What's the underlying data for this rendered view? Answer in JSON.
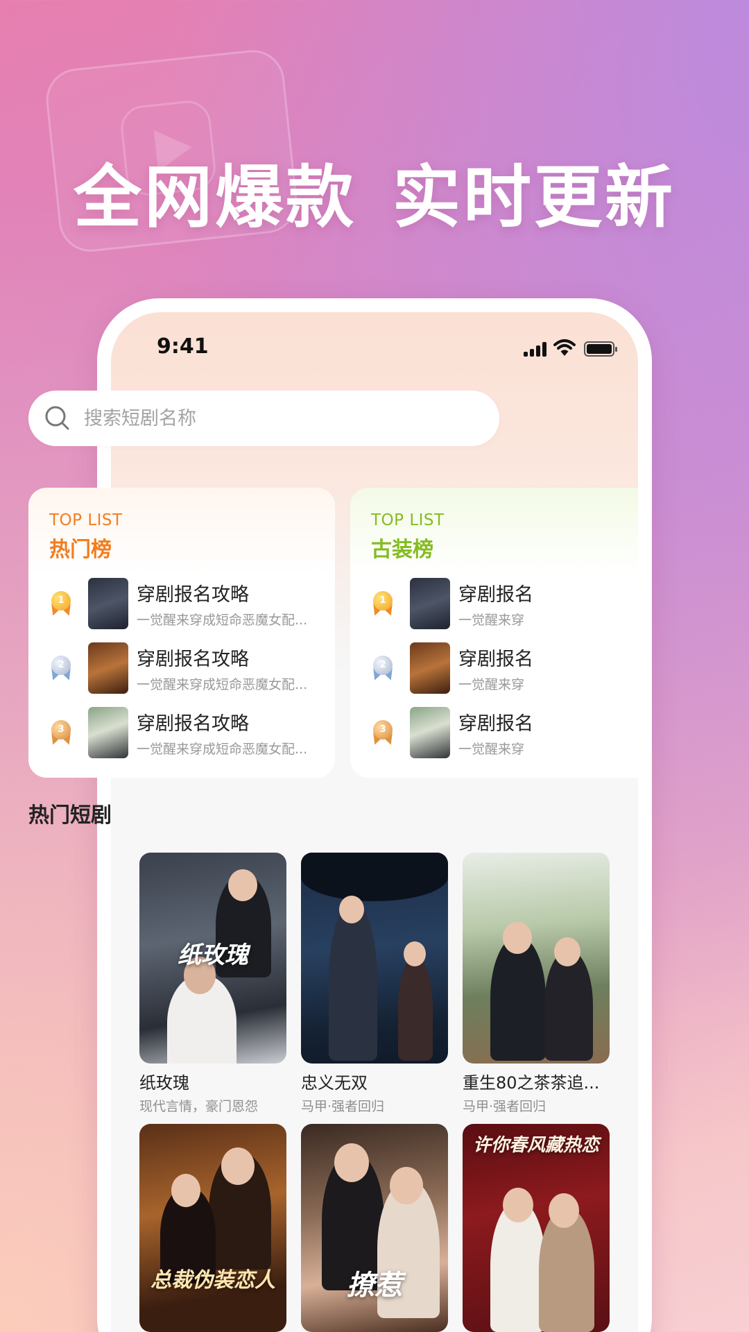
{
  "headline": {
    "part1": "全网爆款",
    "part2": "实时更新"
  },
  "status_bar": {
    "time": "9:41"
  },
  "search": {
    "placeholder": "搜索短剧名称"
  },
  "rank_cards": [
    {
      "eyebrow": "TOP LIST",
      "title": "热门榜",
      "accent": "#f27d1f",
      "items": [
        {
          "rank": "1",
          "name": "穿剧报名攻略",
          "desc": "一觉醒来穿成短命恶魔女配..."
        },
        {
          "rank": "2",
          "name": "穿剧报名攻略",
          "desc": "一觉醒来穿成短命恶魔女配..."
        },
        {
          "rank": "3",
          "name": "穿剧报名攻略",
          "desc": "一觉醒来穿成短命恶魔女配..."
        }
      ]
    },
    {
      "eyebrow": "TOP LIST",
      "title": "古装榜",
      "accent": "#84bc22",
      "items": [
        {
          "rank": "1",
          "name": "穿剧报名",
          "desc": "一觉醒来穿"
        },
        {
          "rank": "2",
          "name": "穿剧报名",
          "desc": "一觉醒来穿"
        },
        {
          "rank": "3",
          "name": "穿剧报名",
          "desc": "一觉醒来穿"
        }
      ]
    }
  ],
  "hot_section": {
    "title": "热门短剧"
  },
  "dramas": [
    {
      "name": "纸玫瑰",
      "tag": "现代言情，豪门恩怨",
      "poster_text": "纸玫瑰"
    },
    {
      "name": "忠义无双",
      "tag": "马甲·强者回归",
      "poster_text": ""
    },
    {
      "name": "重生80之茶茶追...",
      "tag": "马甲·强者回归",
      "poster_text": ""
    },
    {
      "name": "",
      "tag": "",
      "poster_text": "总裁伪装恋人"
    },
    {
      "name": "",
      "tag": "",
      "poster_text": "撩惹"
    },
    {
      "name": "",
      "tag": "",
      "poster_text": "许你春风藏热恋"
    }
  ]
}
